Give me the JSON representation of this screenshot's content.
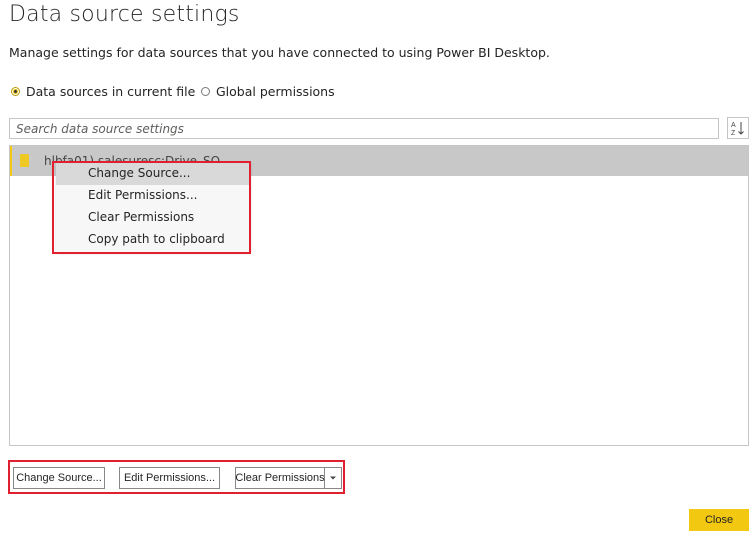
{
  "dialog": {
    "title": "Data source settings",
    "subtitle": "Manage settings for data sources that you have connected to using Power BI Desktop."
  },
  "scope": {
    "options": [
      {
        "label": "Data sources in current file",
        "selected": true
      },
      {
        "label": "Global permissions",
        "selected": false
      }
    ]
  },
  "search": {
    "placeholder": "Search data source settings",
    "sort_icon": "sort-az-icon"
  },
  "sources": [
    {
      "label": "hlbfa01).salesuresc;Drive_SO",
      "icon": "database-icon",
      "selected": true
    }
  ],
  "context_menu": {
    "items": [
      {
        "label": "Change Source...",
        "hover": true
      },
      {
        "label": "Edit Permissions..."
      },
      {
        "label": "Clear Permissions"
      },
      {
        "label": "Copy path to clipboard"
      }
    ]
  },
  "actions": {
    "change_source": "Change Source...",
    "edit_permissions": "Edit Permissions...",
    "clear_permissions": "Clear Permissions",
    "close": "Close"
  },
  "colors": {
    "accent": "#f2c811",
    "highlight_border": "#e0202e",
    "selected_row": "#c8c8c8"
  }
}
